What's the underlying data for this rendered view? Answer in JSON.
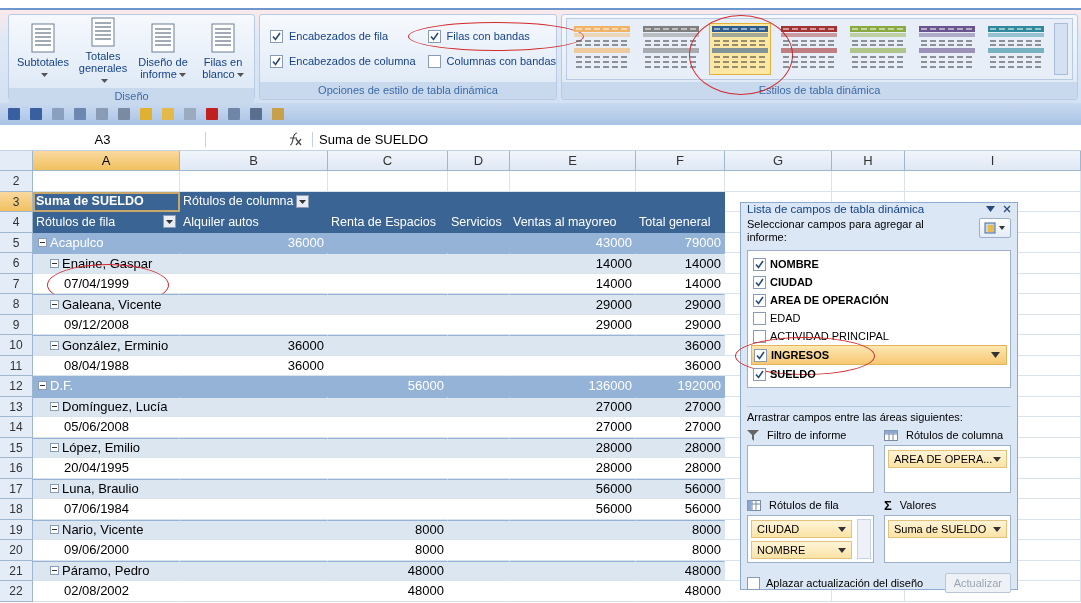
{
  "ribbon": {
    "groups": [
      {
        "kind": "buttons",
        "label": "Diseño",
        "buttons": [
          {
            "label": "Subtotales",
            "dropdown": true
          },
          {
            "label": "Totales generales",
            "dropdown": true
          },
          {
            "label": "Diseño de informe",
            "dropdown": true
          },
          {
            "label": "Filas en blanco",
            "dropdown": true
          }
        ]
      },
      {
        "kind": "options",
        "label": "Opciones de estilo de tabla dinámica",
        "options": [
          {
            "label": "Encabezados de fila",
            "checked": true,
            "highlight": false
          },
          {
            "label": "Filas con bandas",
            "checked": true,
            "highlight": true
          },
          {
            "label": "Encabezados de columna",
            "checked": true,
            "highlight": false
          },
          {
            "label": "Columnas con bandas",
            "checked": false,
            "highlight": false
          }
        ]
      },
      {
        "kind": "styles",
        "label": "Estilos de tabla dinámica",
        "styles": [
          {
            "color": "#f2b366",
            "selected": false,
            "highlight": false
          },
          {
            "color": "#7f7f7f",
            "selected": false,
            "highlight": false
          },
          {
            "color": "#2f5c8f",
            "selected": true,
            "highlight": true
          },
          {
            "color": "#a33333",
            "selected": false,
            "highlight": false
          },
          {
            "color": "#8aaa3f",
            "selected": false,
            "highlight": false
          },
          {
            "color": "#6a548f",
            "selected": false,
            "highlight": false
          },
          {
            "color": "#2f8a9e",
            "selected": false,
            "highlight": false
          }
        ]
      }
    ]
  },
  "formula_bar": {
    "name_box": "A3",
    "formula": "Suma de SUELDO"
  },
  "sheet": {
    "columns": [
      {
        "label": "A",
        "selected": true
      },
      {
        "label": "B",
        "selected": false
      },
      {
        "label": "C",
        "selected": false
      },
      {
        "label": "D",
        "selected": false
      },
      {
        "label": "E",
        "selected": false
      },
      {
        "label": "F",
        "selected": false
      },
      {
        "label": "G",
        "selected": false
      },
      {
        "label": "H",
        "selected": false
      },
      {
        "label": "I",
        "selected": false
      }
    ],
    "rows": [
      {
        "number": "2",
        "kind": "blank",
        "selected": false
      },
      {
        "number": "3",
        "kind": "title",
        "selected": true,
        "label": "Suma de SUELDO",
        "column_label": "Rótulos de columna"
      },
      {
        "number": "4",
        "kind": "header",
        "selected": false,
        "label": "Rótulos de fila",
        "headers": [
          "Alquiler autos",
          "Renta de Espacios",
          "Servicios",
          "Ventas al mayoreo",
          "Total general"
        ]
      },
      {
        "number": "5",
        "kind": "city",
        "selected": false,
        "expanded": true,
        "label": "Acapulco",
        "values": {
          "alquiler_autos": "36000",
          "ventas_al_mayoreo": "43000",
          "total_general": "79000"
        }
      },
      {
        "number": "6",
        "kind": "person",
        "selected": false,
        "expanded": true,
        "label": "Enaine, Gaspar",
        "values": {
          "ventas_al_mayoreo": "14000",
          "total_general": "14000"
        }
      },
      {
        "number": "7",
        "kind": "date",
        "selected": false,
        "highlight": true,
        "label": "07/04/1999",
        "values": {
          "ventas_al_mayoreo": "14000",
          "total_general": "14000"
        }
      },
      {
        "number": "8",
        "kind": "person",
        "selected": false,
        "expanded": true,
        "label": "Galeana, Vicente",
        "values": {
          "ventas_al_mayoreo": "29000",
          "total_general": "29000"
        }
      },
      {
        "number": "9",
        "kind": "date",
        "selected": false,
        "label": "09/12/2008",
        "values": {
          "ventas_al_mayoreo": "29000",
          "total_general": "29000"
        }
      },
      {
        "number": "10",
        "kind": "person",
        "selected": false,
        "expanded": true,
        "label": "González, Erminio",
        "values": {
          "alquiler_autos": "36000",
          "total_general": "36000"
        }
      },
      {
        "number": "11",
        "kind": "date",
        "selected": false,
        "label": "08/04/1988",
        "values": {
          "alquiler_autos": "36000",
          "total_general": "36000"
        }
      },
      {
        "number": "12",
        "kind": "city",
        "selected": false,
        "expanded": true,
        "label": "D.F.",
        "values": {
          "renta_de_espacios": "56000",
          "ventas_al_mayoreo": "136000",
          "total_general": "192000"
        }
      },
      {
        "number": "13",
        "kind": "person",
        "selected": false,
        "expanded": true,
        "label": "Domínguez, Lucía",
        "values": {
          "ventas_al_mayoreo": "27000",
          "total_general": "27000"
        }
      },
      {
        "number": "14",
        "kind": "date",
        "selected": false,
        "label": "05/06/2008",
        "values": {
          "ventas_al_mayoreo": "27000",
          "total_general": "27000"
        }
      },
      {
        "number": "15",
        "kind": "person",
        "selected": false,
        "expanded": true,
        "label": "López, Emilio",
        "values": {
          "ventas_al_mayoreo": "28000",
          "total_general": "28000"
        }
      },
      {
        "number": "16",
        "kind": "date",
        "selected": false,
        "label": "20/04/1995",
        "values": {
          "ventas_al_mayoreo": "28000",
          "total_general": "28000"
        }
      },
      {
        "number": "17",
        "kind": "person",
        "selected": false,
        "expanded": true,
        "label": "Luna, Braulio",
        "values": {
          "ventas_al_mayoreo": "56000",
          "total_general": "56000"
        }
      },
      {
        "number": "18",
        "kind": "date",
        "selected": false,
        "label": "07/06/1984",
        "values": {
          "ventas_al_mayoreo": "56000",
          "total_general": "56000"
        }
      },
      {
        "number": "19",
        "kind": "person",
        "selected": false,
        "expanded": true,
        "label": "Nario, Vicente",
        "values": {
          "renta_de_espacios": "8000",
          "total_general": "8000"
        }
      },
      {
        "number": "20",
        "kind": "date",
        "selected": false,
        "label": "09/06/2000",
        "values": {
          "renta_de_espacios": "8000",
          "total_general": "8000"
        }
      },
      {
        "number": "21",
        "kind": "person",
        "selected": false,
        "expanded": true,
        "label": "Páramo, Pedro",
        "values": {
          "renta_de_espacios": "48000",
          "total_general": "48000"
        }
      },
      {
        "number": "22",
        "kind": "date",
        "selected": false,
        "label": "02/08/2002",
        "values": {
          "renta_de_espacios": "48000",
          "total_general": "48000"
        }
      }
    ]
  },
  "field_list": {
    "title": "Lista de campos de tabla dinámica",
    "instruction": "Seleccionar campos para agregar al informe:",
    "fields": [
      {
        "name": "NOMBRE",
        "checked": true,
        "selected": false,
        "highlight": false
      },
      {
        "name": "CIUDAD",
        "checked": true,
        "selected": false,
        "highlight": false
      },
      {
        "name": "AREA DE OPERACIÓN",
        "checked": true,
        "selected": false,
        "highlight": false
      },
      {
        "name": "EDAD",
        "checked": false,
        "selected": false,
        "highlight": false
      },
      {
        "name": "ACTIVIDAD PRINCIPAL",
        "checked": false,
        "selected": false,
        "highlight": false
      },
      {
        "name": "INGRESOS",
        "checked": true,
        "selected": true,
        "highlight": true
      },
      {
        "name": "SUELDO",
        "checked": true,
        "selected": false,
        "highlight": false
      }
    ],
    "drag_instruction": "Arrastrar campos entre las áreas siguientes:",
    "areas": [
      {
        "kind": "filter",
        "title": "Filtro de informe"
      },
      {
        "kind": "columns",
        "title": "Rótulos de columna",
        "items": [
          "AREA DE OPERA..."
        ]
      },
      {
        "kind": "rows",
        "title": "Rótulos de fila",
        "items": [
          "CIUDAD",
          "NOMBRE"
        ]
      },
      {
        "kind": "values",
        "symbol": "Σ",
        "title": "Valores",
        "items": [
          "Suma de SUELDO"
        ]
      }
    ],
    "defer": {
      "label": "Aplazar actualización del diseño",
      "checked": false
    },
    "update_button": {
      "label": "Actualizar",
      "disabled": true
    }
  }
}
